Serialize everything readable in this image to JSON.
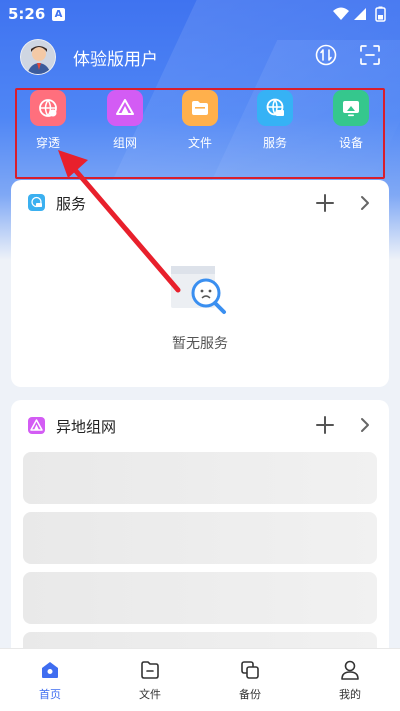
{
  "status_bar": {
    "time": "5:26",
    "notif_letter": "A"
  },
  "header": {
    "username": "体验版用户"
  },
  "quick_actions": [
    {
      "label": "穿透",
      "icon": "globe-app-icon",
      "color": "#ff6f7d"
    },
    {
      "label": "组网",
      "icon": "network-triangle-icon",
      "color": "#d35cf4"
    },
    {
      "label": "文件",
      "icon": "folder-icon",
      "color": "#ffb04c"
    },
    {
      "label": "服务",
      "icon": "globe-service-icon",
      "color": "#36b2f5"
    },
    {
      "label": "设备",
      "icon": "device-icon",
      "color": "#35c78d"
    }
  ],
  "services_card": {
    "title": "服务",
    "empty_text": "暂无服务"
  },
  "network_card": {
    "title": "异地组网"
  },
  "bottom_nav": [
    {
      "label": "首页",
      "active": true
    },
    {
      "label": "文件",
      "active": false
    },
    {
      "label": "备份",
      "active": false
    },
    {
      "label": "我的",
      "active": false
    }
  ],
  "colors": {
    "accent": "#3f6df0",
    "annotation": "#d81e2c"
  }
}
